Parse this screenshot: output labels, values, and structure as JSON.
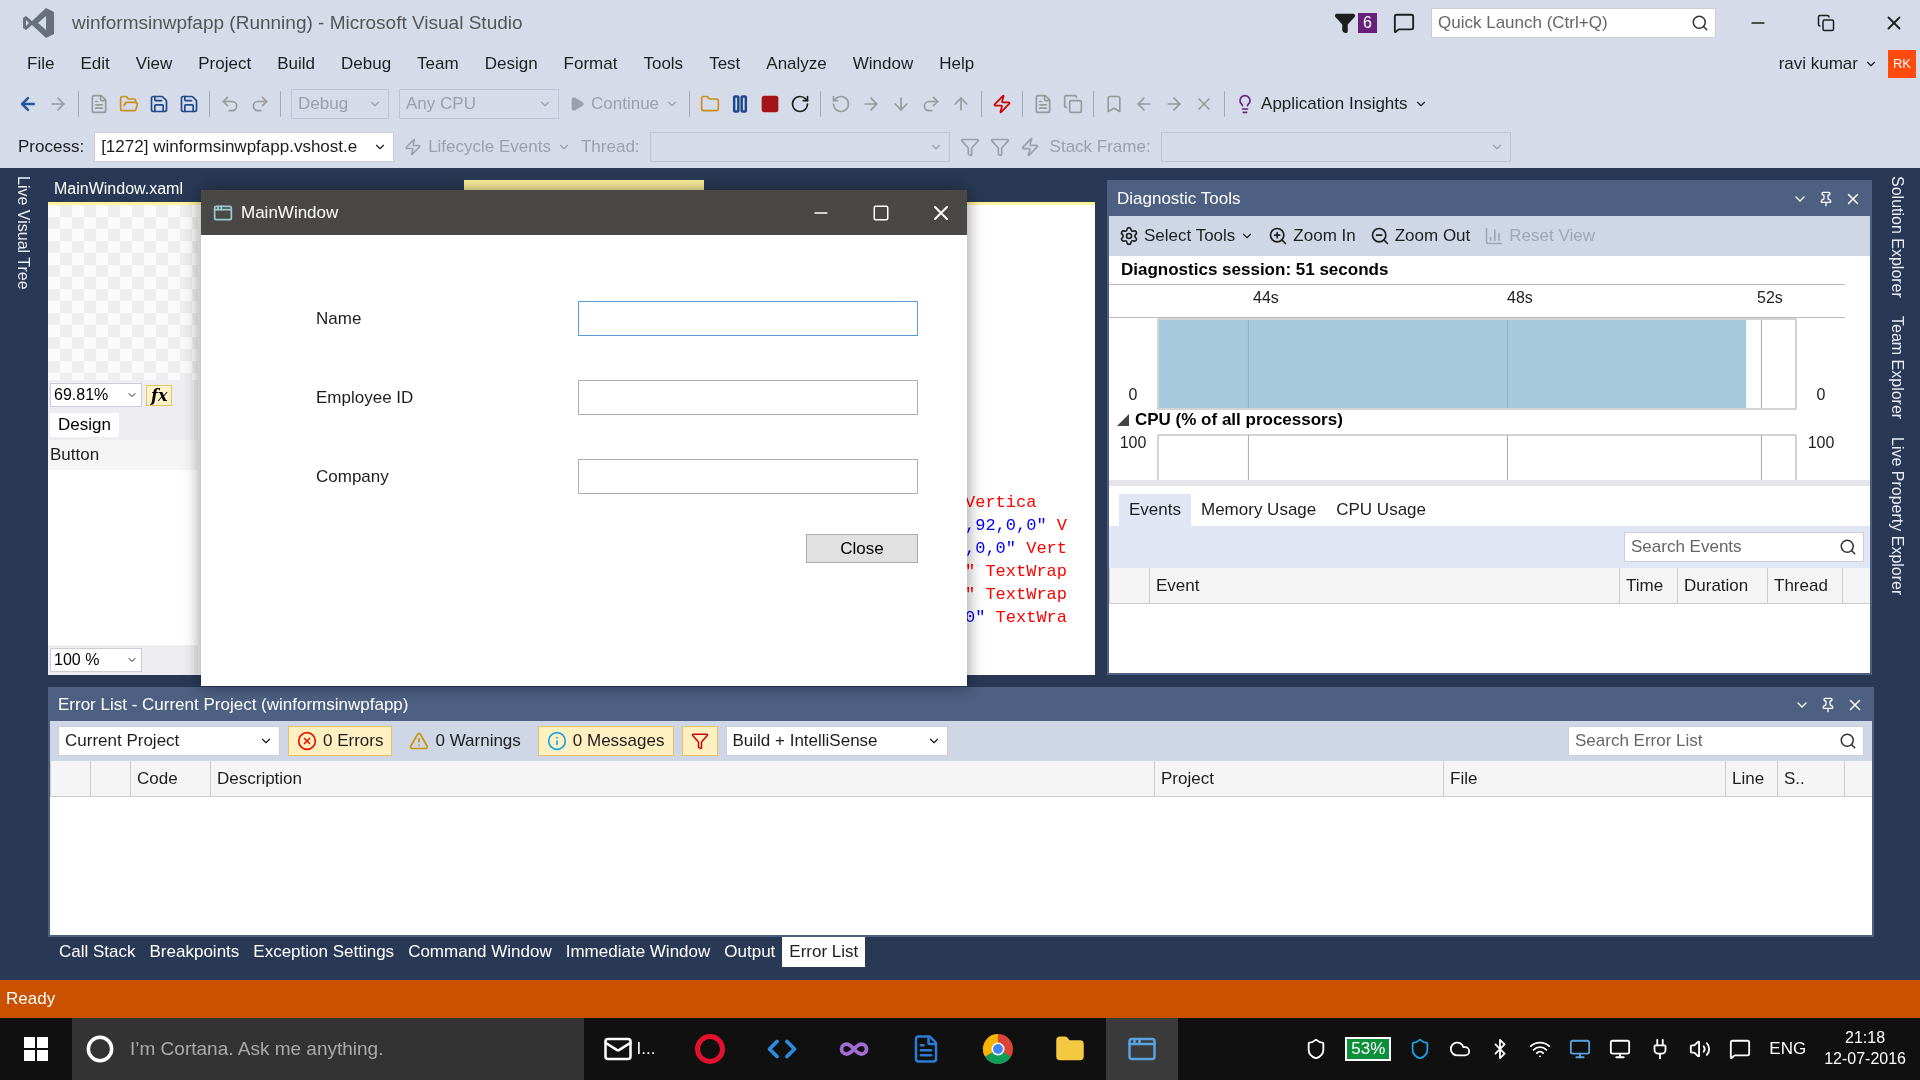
{
  "window": {
    "title": "winformsinwpfapp (Running) - Microsoft Visual Studio",
    "notification_count": "6",
    "quick_launch": {
      "placeholder": "Quick Launch (Ctrl+Q)"
    }
  },
  "menu": [
    "File",
    "Edit",
    "View",
    "Project",
    "Build",
    "Debug",
    "Team",
    "Design",
    "Format",
    "Tools",
    "Test",
    "Analyze",
    "Window",
    "Help"
  ],
  "account": {
    "name": "ravi kumar",
    "initials": "RK"
  },
  "toolbar": {
    "configuration": "Debug",
    "platform": "Any CPU",
    "continue": "Continue",
    "insights": "Application Insights"
  },
  "debug_location": {
    "process_label": "Process:",
    "process": "[1272] winformsinwpfapp.vshost.e",
    "lifecycle": "Lifecycle Events",
    "thread_label": "Thread:",
    "stack_frame_label": "Stack Frame:"
  },
  "left_tabs": [
    "Live Visual Tree"
  ],
  "right_tabs": [
    "Solution Explorer",
    "Team Explorer",
    "Live Property Explorer"
  ],
  "editor": {
    "tabs": [
      {
        "label": "MainWindow.xaml",
        "selected": false
      },
      {
        "selected": true
      }
    ],
    "zoom": "69.81%",
    "fx": "fx",
    "view_tab": "Design",
    "element": "Button",
    "code_zoom": "100 %",
    "code_lines": [
      [
        {
          "text": "Vertica",
          "color": "#ff0000"
        }
      ],
      [
        {
          "text": ",92,0,0\"",
          "color": "#0000ff"
        },
        {
          "text": " V",
          "color": "#ff0000"
        }
      ],
      [
        {
          "text": ",0,0\"",
          "color": "#0000ff"
        },
        {
          "text": " Vert",
          "color": "#ff0000"
        }
      ],
      [
        {
          "text": "\" TextWrap",
          "color": "#ff0000"
        }
      ],
      [
        {
          "text": "\" TextWrap",
          "color": "#ff0000"
        }
      ],
      [
        {
          "text": "0\"",
          "color": "#0000ff"
        },
        {
          "text": " TextWra",
          "color": "#ff0000"
        }
      ]
    ]
  },
  "diagnostics": {
    "title": "Diagnostic Tools",
    "tools": [
      {
        "kind": "select",
        "label": "Select Tools",
        "disabled": false
      },
      {
        "kind": "zoom-in",
        "label": "Zoom In",
        "disabled": false
      },
      {
        "kind": "zoom-out",
        "label": "Zoom Out",
        "disabled": false
      },
      {
        "kind": "reset",
        "label": "Reset View",
        "disabled": true
      }
    ],
    "session": "Diagnostics session: 51 seconds",
    "ticks": [
      "44s",
      "48s",
      "52s"
    ],
    "memory_axis": [
      "0",
      "0"
    ],
    "cpu_title": "CPU (% of all processors)",
    "cpu_axis": [
      "100",
      "100"
    ],
    "tabs": [
      {
        "label": "Events",
        "selected": true
      },
      {
        "label": "Memory Usage",
        "selected": false
      },
      {
        "label": "CPU Usage",
        "selected": false
      }
    ],
    "search": {
      "placeholder": "Search Events"
    },
    "columns": [
      "Event",
      "Time",
      "Duration",
      "Thread"
    ]
  },
  "error_list": {
    "title": "Error List - Current Project (winformsinwpfapp)",
    "scope": "Current Project",
    "filters": [
      {
        "kind": "error",
        "label": "0 Errors",
        "on": true
      },
      {
        "kind": "warning",
        "label": "0 Warnings",
        "on": false
      },
      {
        "kind": "message",
        "label": "0 Messages",
        "on": true
      }
    ],
    "source": "Build + IntelliSense",
    "search": {
      "placeholder": "Search Error List"
    },
    "columns": [
      "Code",
      "Description",
      "Project",
      "File",
      "Line",
      "S.."
    ]
  },
  "bottom_tabs": [
    {
      "label": "Call Stack",
      "selected": false
    },
    {
      "label": "Breakpoints",
      "selected": false
    },
    {
      "label": "Exception Settings",
      "selected": false
    },
    {
      "label": "Command Window",
      "selected": false
    },
    {
      "label": "Immediate Window",
      "selected": false
    },
    {
      "label": "Output",
      "selected": false
    },
    {
      "label": "Error List",
      "selected": true
    }
  ],
  "status": "Ready",
  "taskbar": {
    "search": {
      "placeholder": "I’m Cortana. Ask me anything."
    },
    "mail_label": "I...",
    "battery": "53%",
    "language": "ENG",
    "time": "21:18",
    "date": "12-07-2016"
  },
  "dialog": {
    "title": "MainWindow",
    "fields": [
      {
        "label": "Name",
        "focused": true
      },
      {
        "label": "Employee ID",
        "focused": false
      },
      {
        "label": "Company",
        "focused": false
      }
    ],
    "button": "Close"
  }
}
